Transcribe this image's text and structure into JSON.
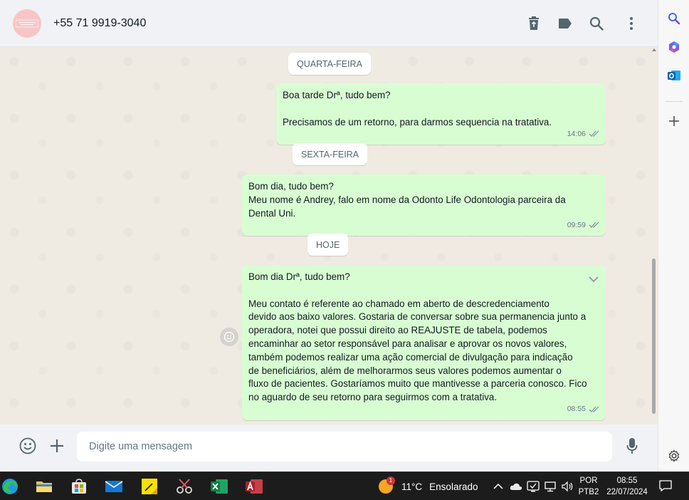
{
  "header": {
    "contact_name": "+55 71 9919-3040"
  },
  "days": [
    {
      "label": "QUARTA-FEIRA"
    },
    {
      "label": "SEXTA-FEIRA"
    },
    {
      "label": "HOJE"
    }
  ],
  "messages": [
    {
      "lines": [
        "Boa tarde Drª, tudo bem?",
        "",
        "Precisamos de um retorno, para darmos sequencia na tratativa."
      ],
      "time": "14:06"
    },
    {
      "lines": [
        "Bom dia, tudo bem?",
        "Meu nome é Andrey, falo em nome da Odonto Life Odontologia parceira da",
        "Dental Uni."
      ],
      "time": "09:59"
    },
    {
      "lines": [
        "Bom dia Drª, tudo bem?",
        "",
        "Meu contato é referente ao chamado em aberto de descredenciamento",
        "devido aos baixo valores. Gostaria de conversar sobre sua permanencia junto a",
        "operadora, notei que possui direito ao REAJUSTE de tabela, podemos",
        "encaminhar ao setor responsável para analisar e aprovar os novos valores,",
        "também podemos realizar uma ação comercial de divulgação para indicação",
        "de beneficiários, além de melhorarmos seus valores podemos aumentar o",
        "fluxo de pacientes. Gostaríamos muito que mantivesse a parceria conosco. Fico",
        "no aguardo de seu retorno para seguirmos com a tratativa."
      ],
      "time": "08:55"
    }
  ],
  "composer": {
    "placeholder": "Digite uma mensagem"
  },
  "taskbar": {
    "weather_temp": "11°C",
    "weather_desc": "Ensolarado",
    "weather_badge": "1",
    "lang_line1": "POR",
    "lang_line2": "PTB2",
    "time": "08:55",
    "date": "22/07/2024"
  },
  "colors": {
    "bubble": "#d9fdd3",
    "chat_background": "#efeae2",
    "header_background": "#f0f2f5",
    "icon": "#54656f",
    "ticks": "#8696a0"
  },
  "icons": {
    "header": [
      "trash-icon",
      "label-icon",
      "search-icon",
      "menu-dots-icon"
    ],
    "composer": [
      "emoji-icon",
      "plus-icon",
      "microphone-icon"
    ],
    "sidebar": [
      "search-icon",
      "copilot-icon",
      "outlook-icon",
      "add-icon",
      "settings-icon"
    ],
    "taskbar": [
      "edge-icon",
      "file-explorer-icon",
      "store-icon",
      "mail-icon",
      "sticky-notes-icon",
      "snipping-tool-icon",
      "excel-icon",
      "access-icon"
    ]
  }
}
